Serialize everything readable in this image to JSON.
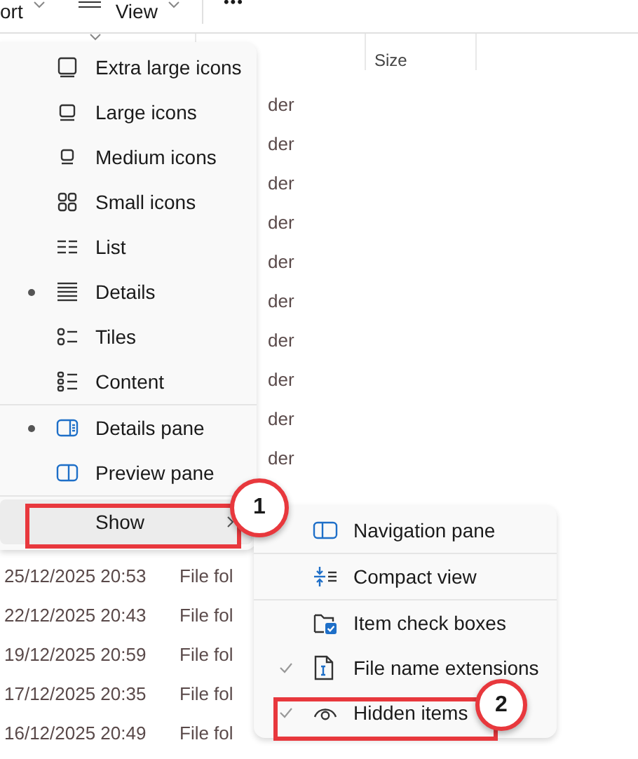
{
  "toolbar": {
    "sort_label": "ort",
    "view_label": "View",
    "more_label": "•••"
  },
  "columns": [
    {
      "label": "Size"
    }
  ],
  "file_rows_above": [
    {
      "type": "der"
    },
    {
      "type": "der"
    },
    {
      "type": "der"
    },
    {
      "type": "der"
    },
    {
      "type": "der"
    },
    {
      "type": "der"
    },
    {
      "type": "der"
    },
    {
      "type": "der"
    },
    {
      "type": "der"
    },
    {
      "type": "der"
    }
  ],
  "file_rows_below": [
    {
      "date": "25/12/2025 20:53",
      "type": "File fol"
    },
    {
      "date": "22/12/2025 20:43",
      "type": "File fol"
    },
    {
      "date": "19/12/2025 20:59",
      "type": "File fol"
    },
    {
      "date": "17/12/2025 20:35",
      "type": "File fol"
    },
    {
      "date": "16/12/2025 20:49",
      "type": "File fol"
    }
  ],
  "view_menu": {
    "groups": [
      [
        {
          "label": "Extra large icons",
          "selected": false
        },
        {
          "label": "Large icons",
          "selected": false
        },
        {
          "label": "Medium icons",
          "selected": false
        },
        {
          "label": "Small icons",
          "selected": false
        },
        {
          "label": "List",
          "selected": false
        },
        {
          "label": "Details",
          "selected": true
        },
        {
          "label": "Tiles",
          "selected": false
        },
        {
          "label": "Content",
          "selected": false
        }
      ],
      [
        {
          "label": "Details pane",
          "selected": true
        },
        {
          "label": "Preview pane",
          "selected": false
        }
      ]
    ],
    "show_item": {
      "label": "Show",
      "highlighted": true
    }
  },
  "show_menu": {
    "groups": [
      [
        {
          "label": "Navigation pane",
          "checked": false
        }
      ],
      [
        {
          "label": "Compact view",
          "checked": false
        }
      ],
      [
        {
          "label": "Item check boxes",
          "checked": false
        },
        {
          "label": "File name extensions",
          "checked": true
        },
        {
          "label": "Hidden items",
          "checked": true
        }
      ]
    ]
  },
  "annotations": [
    {
      "label": "1"
    },
    {
      "label": "2"
    }
  ]
}
